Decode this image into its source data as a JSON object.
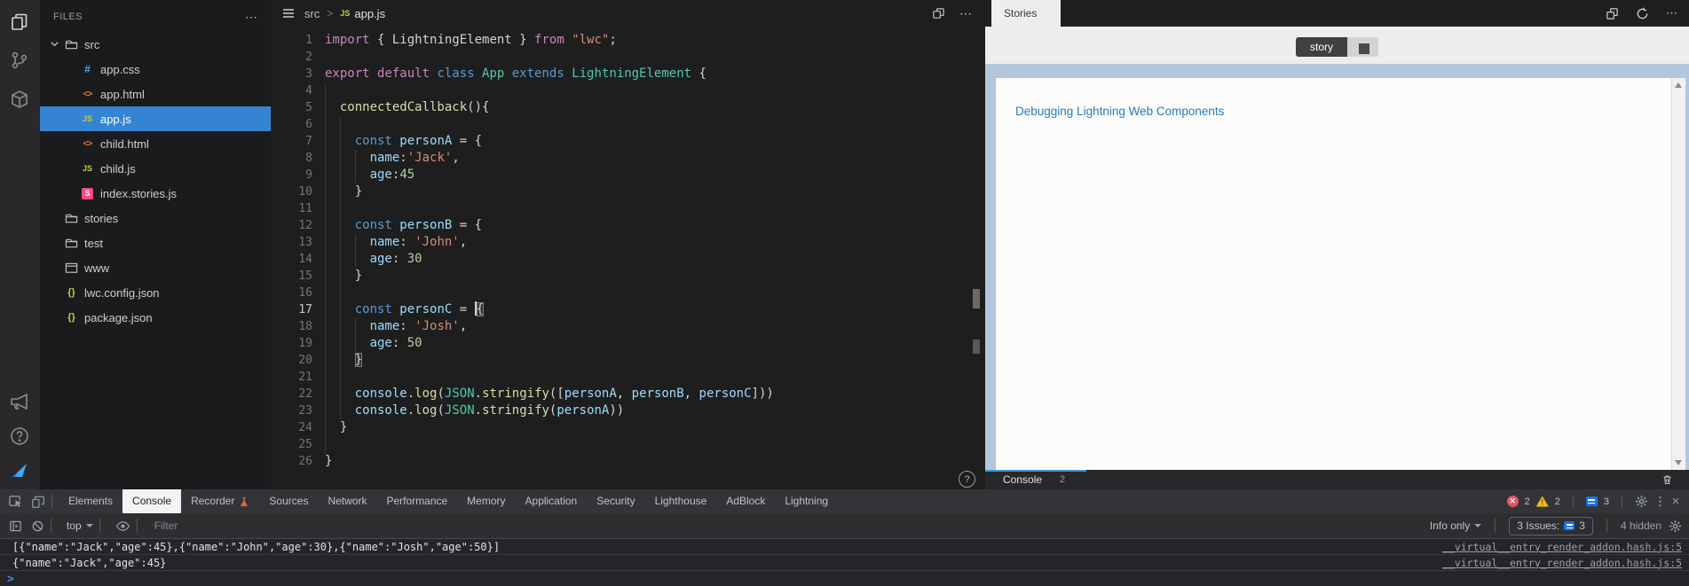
{
  "activity_bar": {
    "items": [
      "files",
      "source-control",
      "package",
      "announcement",
      "help",
      "logo"
    ]
  },
  "explorer": {
    "title": "FILES",
    "more_label": "...",
    "items": [
      {
        "label": "src",
        "icon": "folder",
        "level": 0,
        "chevron": true
      },
      {
        "label": "app.css",
        "icon": "css",
        "level": 1
      },
      {
        "label": "app.html",
        "icon": "html",
        "level": 1
      },
      {
        "label": "app.js",
        "icon": "js",
        "level": 1,
        "selected": true
      },
      {
        "label": "child.html",
        "icon": "html",
        "level": 1
      },
      {
        "label": "child.js",
        "icon": "js",
        "level": 1
      },
      {
        "label": "index.stories.js",
        "icon": "storybook",
        "level": 1
      },
      {
        "label": "stories",
        "icon": "folder",
        "level": 0
      },
      {
        "label": "test",
        "icon": "folder",
        "level": 0
      },
      {
        "label": "www",
        "icon": "window",
        "level": 0
      },
      {
        "label": "lwc.config.json",
        "icon": "json",
        "level": 0
      },
      {
        "label": "package.json",
        "icon": "json",
        "level": 0
      }
    ]
  },
  "editor": {
    "breadcrumb": {
      "root": "src",
      "separator": ">",
      "file_badge": "JS",
      "file": "app.js"
    },
    "help_glyph": "?",
    "lines": [
      {
        "n": 1,
        "tokens": [
          [
            "import ",
            "k1"
          ],
          [
            "{ LightningElement } ",
            "pu"
          ],
          [
            "from ",
            "k1"
          ],
          [
            "\"lwc\"",
            "st"
          ],
          [
            ";",
            "pu"
          ]
        ]
      },
      {
        "n": 2,
        "tokens": []
      },
      {
        "n": 3,
        "tokens": [
          [
            "export ",
            "k1"
          ],
          [
            "default ",
            "k1"
          ],
          [
            "class ",
            "k2"
          ],
          [
            "App ",
            "ty"
          ],
          [
            "extends ",
            "k2"
          ],
          [
            "LightningElement ",
            "ty"
          ],
          [
            "{",
            "pu"
          ]
        ]
      },
      {
        "n": 4,
        "tokens": []
      },
      {
        "n": 5,
        "tokens": [
          [
            "  ",
            "pu"
          ],
          [
            "connectedCallback",
            "fn"
          ],
          [
            "(){",
            "pu"
          ]
        ]
      },
      {
        "n": 6,
        "tokens": []
      },
      {
        "n": 7,
        "tokens": [
          [
            "    ",
            "pu"
          ],
          [
            "const ",
            "k2"
          ],
          [
            "personA ",
            "va"
          ],
          [
            "= {",
            "pu"
          ]
        ]
      },
      {
        "n": 8,
        "tokens": [
          [
            "      ",
            "pu"
          ],
          [
            "name",
            "va"
          ],
          [
            ":",
            "pu"
          ],
          [
            "'Jack'",
            "st"
          ],
          [
            ",",
            "pu"
          ]
        ]
      },
      {
        "n": 9,
        "tokens": [
          [
            "      ",
            "pu"
          ],
          [
            "age",
            "va"
          ],
          [
            ":",
            "pu"
          ],
          [
            "45",
            "nu"
          ]
        ]
      },
      {
        "n": 10,
        "tokens": [
          [
            "    }",
            "pu"
          ]
        ]
      },
      {
        "n": 11,
        "tokens": []
      },
      {
        "n": 12,
        "tokens": [
          [
            "    ",
            "pu"
          ],
          [
            "const ",
            "k2"
          ],
          [
            "personB ",
            "va"
          ],
          [
            "= {",
            "pu"
          ]
        ]
      },
      {
        "n": 13,
        "tokens": [
          [
            "      ",
            "pu"
          ],
          [
            "name",
            "va"
          ],
          [
            ": ",
            "pu"
          ],
          [
            "'John'",
            "st"
          ],
          [
            ",",
            "pu"
          ]
        ]
      },
      {
        "n": 14,
        "tokens": [
          [
            "      ",
            "pu"
          ],
          [
            "age",
            "va"
          ],
          [
            ": ",
            "pu"
          ],
          [
            "30",
            "nu"
          ]
        ]
      },
      {
        "n": 15,
        "tokens": [
          [
            "    }",
            "pu"
          ]
        ]
      },
      {
        "n": 16,
        "tokens": []
      },
      {
        "n": 17,
        "tokens": [
          [
            "    ",
            "pu"
          ],
          [
            "const ",
            "k2"
          ],
          [
            "personC ",
            "va"
          ],
          [
            "= ",
            "pu"
          ],
          [
            "{",
            "bm"
          ]
        ],
        "active": true,
        "caret": true
      },
      {
        "n": 18,
        "tokens": [
          [
            "      ",
            "pu"
          ],
          [
            "name",
            "va"
          ],
          [
            ": ",
            "pu"
          ],
          [
            "'Josh'",
            "st"
          ],
          [
            ",",
            "pu"
          ]
        ]
      },
      {
        "n": 19,
        "tokens": [
          [
            "      ",
            "pu"
          ],
          [
            "age",
            "va"
          ],
          [
            ": ",
            "pu"
          ],
          [
            "50",
            "nu"
          ]
        ]
      },
      {
        "n": 20,
        "tokens": [
          [
            "    ",
            "pu"
          ],
          [
            "}",
            "bm"
          ]
        ]
      },
      {
        "n": 21,
        "tokens": []
      },
      {
        "n": 22,
        "tokens": [
          [
            "    ",
            "pu"
          ],
          [
            "console",
            "va"
          ],
          [
            ".",
            "pu"
          ],
          [
            "log",
            "fn"
          ],
          [
            "(",
            "pu"
          ],
          [
            "JSON",
            "ty"
          ],
          [
            ".",
            "pu"
          ],
          [
            "stringify",
            "fn"
          ],
          [
            "([",
            "pu"
          ],
          [
            "personA",
            "va"
          ],
          [
            ", ",
            "pu"
          ],
          [
            "personB",
            "va"
          ],
          [
            ", ",
            "pu"
          ],
          [
            "personC",
            "va"
          ],
          [
            "]))",
            "pu"
          ]
        ]
      },
      {
        "n": 23,
        "tokens": [
          [
            "    ",
            "pu"
          ],
          [
            "console",
            "va"
          ],
          [
            ".",
            "pu"
          ],
          [
            "log",
            "fn"
          ],
          [
            "(",
            "pu"
          ],
          [
            "JSON",
            "ty"
          ],
          [
            ".",
            "pu"
          ],
          [
            "stringify",
            "fn"
          ],
          [
            "(",
            "pu"
          ],
          [
            "personA",
            "va"
          ],
          [
            "))",
            "pu"
          ]
        ]
      },
      {
        "n": 24,
        "tokens": [
          [
            "  }",
            "pu"
          ]
        ]
      },
      {
        "n": 25,
        "tokens": []
      },
      {
        "n": 26,
        "tokens": [
          [
            "}",
            "pu"
          ]
        ]
      }
    ]
  },
  "stories_panel": {
    "tab": "Stories",
    "toggle_story": "story",
    "link": "Debugging Lightning Web Components",
    "console_label": "Console",
    "console_count": "2"
  },
  "devtools": {
    "tabs": [
      {
        "label": "Elements"
      },
      {
        "label": "Console",
        "active": true
      },
      {
        "label": "Recorder",
        "icon": "flask"
      },
      {
        "label": "Sources"
      },
      {
        "label": "Network"
      },
      {
        "label": "Performance"
      },
      {
        "label": "Memory"
      },
      {
        "label": "Application"
      },
      {
        "label": "Security"
      },
      {
        "label": "Lighthouse"
      },
      {
        "label": "AdBlock"
      },
      {
        "label": "Lightning"
      }
    ],
    "badges": {
      "errors": "2",
      "warnings": "2",
      "issues": "3"
    },
    "toolbar": {
      "context": "top",
      "filter_placeholder": "Filter",
      "level": "Info only",
      "issues_label": "3 Issues:",
      "issues_count": "3",
      "hidden_label": "4 hidden"
    },
    "logs": [
      {
        "text": "[{\"name\":\"Jack\",\"age\":45},{\"name\":\"John\",\"age\":30},{\"name\":\"Josh\",\"age\":50}]",
        "source": "__virtual__entry_render_addon.hash.js:5"
      },
      {
        "text": "{\"name\":\"Jack\",\"age\":45}",
        "source": "__virtual__entry_render_addon.hash.js:5"
      }
    ],
    "prompt_glyph": ">"
  },
  "colors": {
    "selection_blue": "#3584d3",
    "story_link_blue": "#2a7ab9",
    "story_bg_blue": "#b2c6de",
    "console_tab_accent": "#4596d3",
    "error_red": "#e5545c",
    "warning_yellow": "#f2bd0e",
    "issues_blue": "#1a73e8",
    "prompt_blue": "#4a8df0",
    "storybook_pink": "#ff4785"
  }
}
